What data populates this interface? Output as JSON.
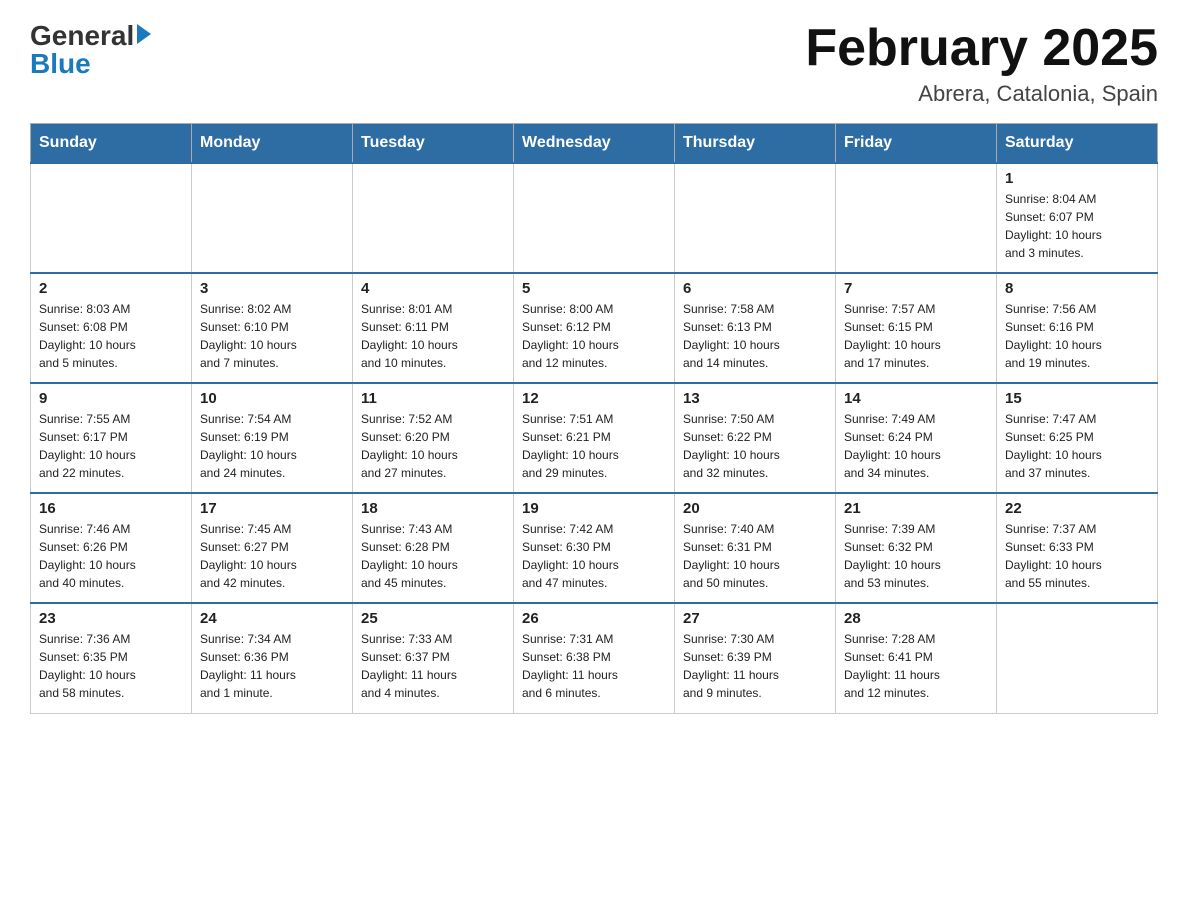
{
  "header": {
    "logo_general": "General",
    "logo_blue": "Blue",
    "month_year": "February 2025",
    "location": "Abrera, Catalonia, Spain"
  },
  "weekdays": [
    "Sunday",
    "Monday",
    "Tuesday",
    "Wednesday",
    "Thursday",
    "Friday",
    "Saturday"
  ],
  "weeks": [
    [
      {
        "day": "",
        "info": ""
      },
      {
        "day": "",
        "info": ""
      },
      {
        "day": "",
        "info": ""
      },
      {
        "day": "",
        "info": ""
      },
      {
        "day": "",
        "info": ""
      },
      {
        "day": "",
        "info": ""
      },
      {
        "day": "1",
        "info": "Sunrise: 8:04 AM\nSunset: 6:07 PM\nDaylight: 10 hours\nand 3 minutes."
      }
    ],
    [
      {
        "day": "2",
        "info": "Sunrise: 8:03 AM\nSunset: 6:08 PM\nDaylight: 10 hours\nand 5 minutes."
      },
      {
        "day": "3",
        "info": "Sunrise: 8:02 AM\nSunset: 6:10 PM\nDaylight: 10 hours\nand 7 minutes."
      },
      {
        "day": "4",
        "info": "Sunrise: 8:01 AM\nSunset: 6:11 PM\nDaylight: 10 hours\nand 10 minutes."
      },
      {
        "day": "5",
        "info": "Sunrise: 8:00 AM\nSunset: 6:12 PM\nDaylight: 10 hours\nand 12 minutes."
      },
      {
        "day": "6",
        "info": "Sunrise: 7:58 AM\nSunset: 6:13 PM\nDaylight: 10 hours\nand 14 minutes."
      },
      {
        "day": "7",
        "info": "Sunrise: 7:57 AM\nSunset: 6:15 PM\nDaylight: 10 hours\nand 17 minutes."
      },
      {
        "day": "8",
        "info": "Sunrise: 7:56 AM\nSunset: 6:16 PM\nDaylight: 10 hours\nand 19 minutes."
      }
    ],
    [
      {
        "day": "9",
        "info": "Sunrise: 7:55 AM\nSunset: 6:17 PM\nDaylight: 10 hours\nand 22 minutes."
      },
      {
        "day": "10",
        "info": "Sunrise: 7:54 AM\nSunset: 6:19 PM\nDaylight: 10 hours\nand 24 minutes."
      },
      {
        "day": "11",
        "info": "Sunrise: 7:52 AM\nSunset: 6:20 PM\nDaylight: 10 hours\nand 27 minutes."
      },
      {
        "day": "12",
        "info": "Sunrise: 7:51 AM\nSunset: 6:21 PM\nDaylight: 10 hours\nand 29 minutes."
      },
      {
        "day": "13",
        "info": "Sunrise: 7:50 AM\nSunset: 6:22 PM\nDaylight: 10 hours\nand 32 minutes."
      },
      {
        "day": "14",
        "info": "Sunrise: 7:49 AM\nSunset: 6:24 PM\nDaylight: 10 hours\nand 34 minutes."
      },
      {
        "day": "15",
        "info": "Sunrise: 7:47 AM\nSunset: 6:25 PM\nDaylight: 10 hours\nand 37 minutes."
      }
    ],
    [
      {
        "day": "16",
        "info": "Sunrise: 7:46 AM\nSunset: 6:26 PM\nDaylight: 10 hours\nand 40 minutes."
      },
      {
        "day": "17",
        "info": "Sunrise: 7:45 AM\nSunset: 6:27 PM\nDaylight: 10 hours\nand 42 minutes."
      },
      {
        "day": "18",
        "info": "Sunrise: 7:43 AM\nSunset: 6:28 PM\nDaylight: 10 hours\nand 45 minutes."
      },
      {
        "day": "19",
        "info": "Sunrise: 7:42 AM\nSunset: 6:30 PM\nDaylight: 10 hours\nand 47 minutes."
      },
      {
        "day": "20",
        "info": "Sunrise: 7:40 AM\nSunset: 6:31 PM\nDaylight: 10 hours\nand 50 minutes."
      },
      {
        "day": "21",
        "info": "Sunrise: 7:39 AM\nSunset: 6:32 PM\nDaylight: 10 hours\nand 53 minutes."
      },
      {
        "day": "22",
        "info": "Sunrise: 7:37 AM\nSunset: 6:33 PM\nDaylight: 10 hours\nand 55 minutes."
      }
    ],
    [
      {
        "day": "23",
        "info": "Sunrise: 7:36 AM\nSunset: 6:35 PM\nDaylight: 10 hours\nand 58 minutes."
      },
      {
        "day": "24",
        "info": "Sunrise: 7:34 AM\nSunset: 6:36 PM\nDaylight: 11 hours\nand 1 minute."
      },
      {
        "day": "25",
        "info": "Sunrise: 7:33 AM\nSunset: 6:37 PM\nDaylight: 11 hours\nand 4 minutes."
      },
      {
        "day": "26",
        "info": "Sunrise: 7:31 AM\nSunset: 6:38 PM\nDaylight: 11 hours\nand 6 minutes."
      },
      {
        "day": "27",
        "info": "Sunrise: 7:30 AM\nSunset: 6:39 PM\nDaylight: 11 hours\nand 9 minutes."
      },
      {
        "day": "28",
        "info": "Sunrise: 7:28 AM\nSunset: 6:41 PM\nDaylight: 11 hours\nand 12 minutes."
      },
      {
        "day": "",
        "info": ""
      }
    ]
  ]
}
